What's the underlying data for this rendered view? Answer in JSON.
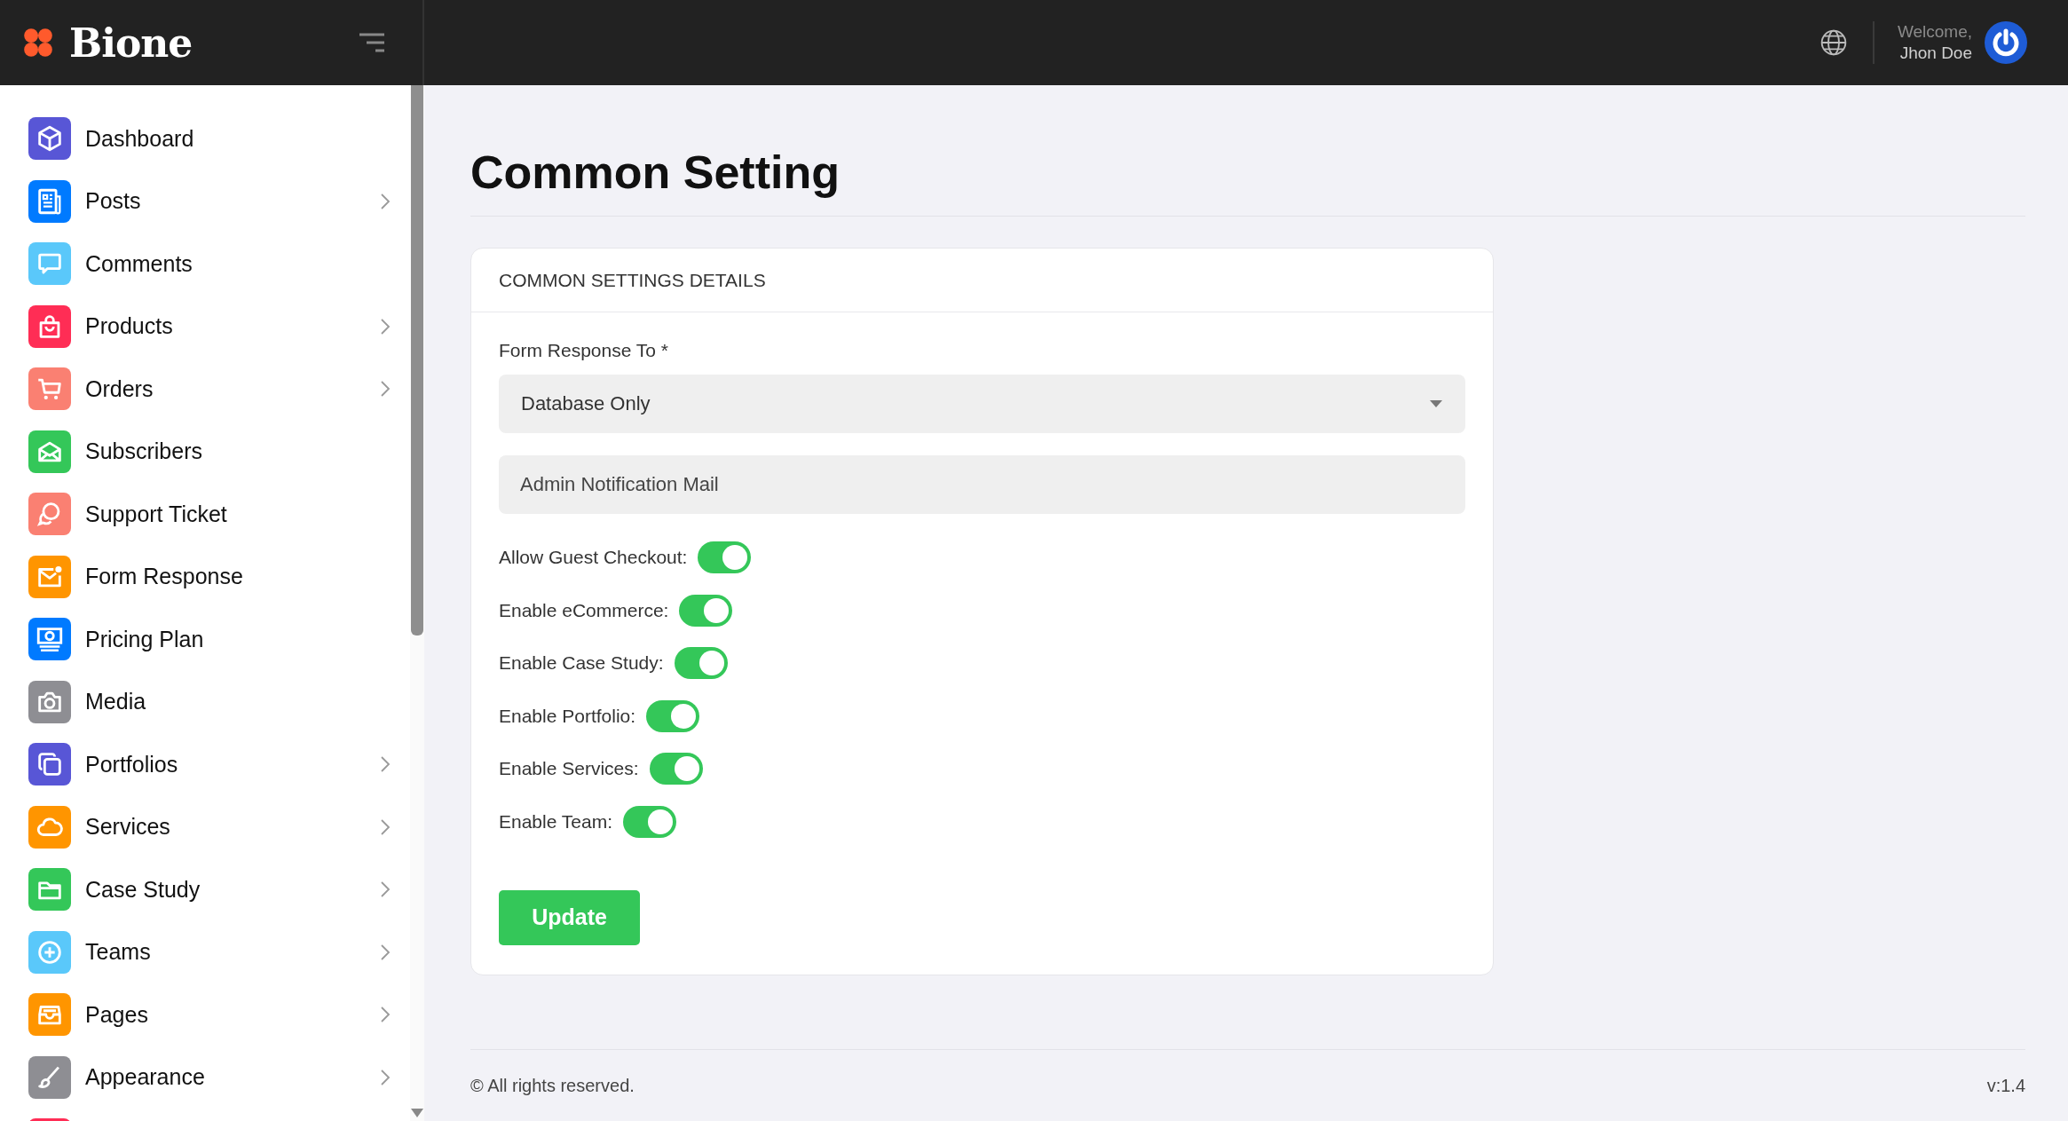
{
  "header": {
    "brand": "Bione",
    "welcome": "Welcome,",
    "user_name": "Jhon Doe"
  },
  "sidebar": {
    "items": [
      {
        "kind": "cube",
        "label": "Dashboard",
        "color": "#5856d6",
        "expandable": false
      },
      {
        "kind": "news",
        "label": "Posts",
        "color": "#007aff",
        "expandable": true
      },
      {
        "kind": "chat",
        "label": "Comments",
        "color": "#5ac8fa",
        "expandable": false
      },
      {
        "kind": "bag",
        "label": "Products",
        "color": "#ff2d55",
        "expandable": true
      },
      {
        "kind": "cart",
        "label": "Orders",
        "color": "#fa8072",
        "expandable": true
      },
      {
        "kind": "envelope",
        "label": "Subscribers",
        "color": "#34c759",
        "expandable": false
      },
      {
        "kind": "bubbles",
        "label": "Support Ticket",
        "color": "#fa8072",
        "expandable": false
      },
      {
        "kind": "mail-dot",
        "label": "Form Response",
        "color": "#ff9500",
        "expandable": false
      },
      {
        "kind": "money",
        "label": "Pricing Plan",
        "color": "#007aff",
        "expandable": false
      },
      {
        "kind": "camera",
        "label": "Media",
        "color": "#8e8e93",
        "expandable": false
      },
      {
        "kind": "copy",
        "label": "Portfolios",
        "color": "#5856d6",
        "expandable": true
      },
      {
        "kind": "cloud",
        "label": "Services",
        "color": "#ff9500",
        "expandable": true
      },
      {
        "kind": "folder",
        "label": "Case Study",
        "color": "#34c759",
        "expandable": true
      },
      {
        "kind": "plus",
        "label": "Teams",
        "color": "#5ac8fa",
        "expandable": true
      },
      {
        "kind": "tray",
        "label": "Pages",
        "color": "#ff9500",
        "expandable": true
      },
      {
        "kind": "brush",
        "label": "Appearance",
        "color": "#8e8e93",
        "expandable": true
      },
      {
        "kind": "partial",
        "color": "#ff2d55",
        "expandable": false
      }
    ]
  },
  "page": {
    "title": "Common Setting"
  },
  "card": {
    "title": "COMMON SETTINGS DETAILS",
    "select": {
      "label": "Form Response To *",
      "value": "Database Only"
    },
    "input": {
      "placeholder": "Admin Notification Mail"
    },
    "toggles": [
      {
        "label": "Allow Guest Checkout:",
        "on": true
      },
      {
        "label": "Enable eCommerce:",
        "on": true
      },
      {
        "label": "Enable Case Study:",
        "on": true
      },
      {
        "label": "Enable Portfolio:",
        "on": true
      },
      {
        "label": "Enable Services:",
        "on": true
      },
      {
        "label": "Enable Team:",
        "on": true
      }
    ],
    "button": "Update"
  },
  "footer": {
    "copyright": "© All rights reserved.",
    "version": "v:1.4"
  }
}
